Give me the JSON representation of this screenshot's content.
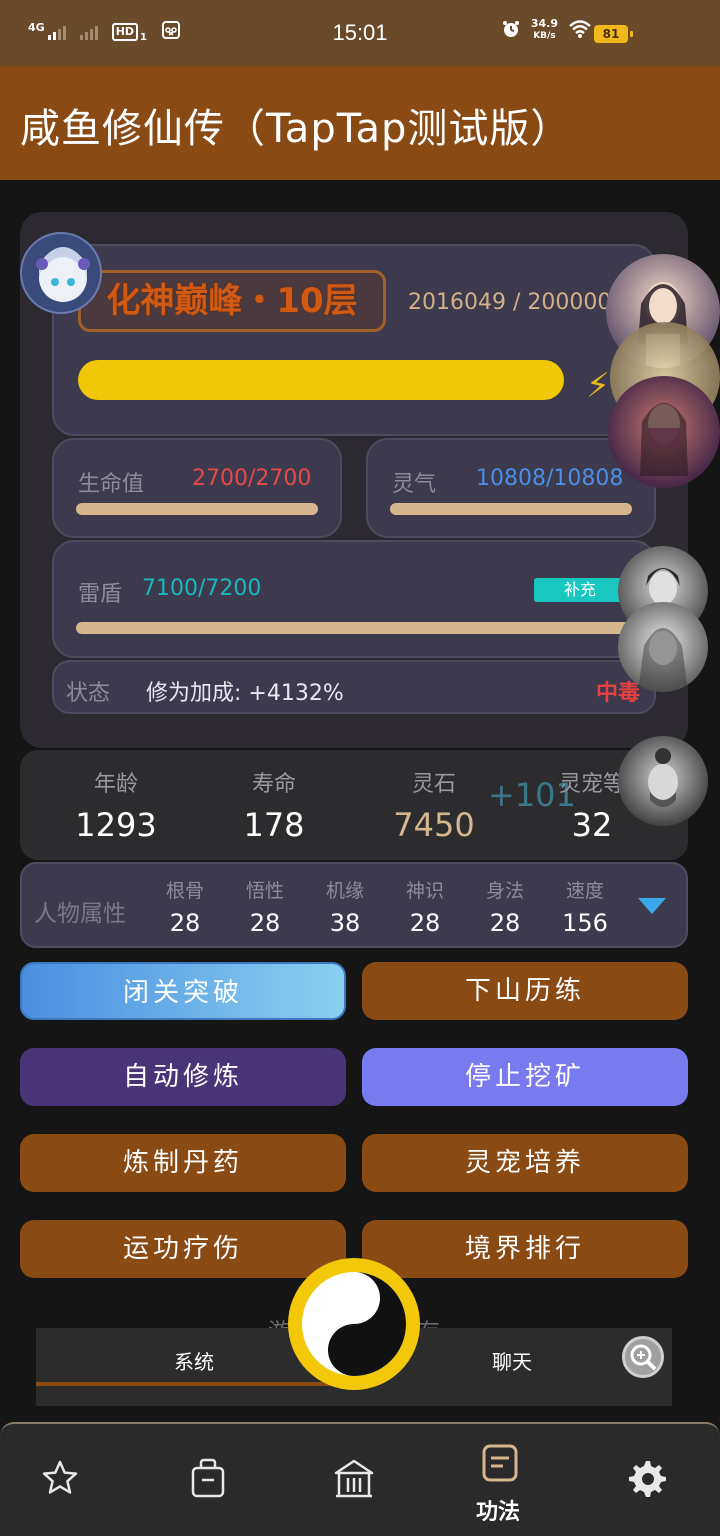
{
  "status_bar": {
    "network": "4G",
    "hd": "HD",
    "hd_sub": "1",
    "time": "15:01",
    "speed_value": "34.9",
    "speed_unit": "KB/s",
    "battery": "81"
  },
  "app": {
    "title": "咸鱼修仙传（TapTap测试版）"
  },
  "realm": {
    "name": "化神巅峰・10层",
    "exp": "2016049 / 2000000",
    "exp_fraction": 1.0
  },
  "hp": {
    "label": "生命值",
    "value": "2700/2700",
    "color": "#e54848"
  },
  "spirit": {
    "label": "灵气",
    "value": "10808/10808",
    "color": "#4a8ee8"
  },
  "shield": {
    "label": "雷盾",
    "value": "7100/7200",
    "color": "#18b8c0",
    "refill_label": "补充"
  },
  "status": {
    "label": "状态",
    "bonus": "修为加成: +4132%",
    "effect": "中毒",
    "effect_color": "#e84040"
  },
  "stats": [
    {
      "label": "年龄",
      "value": "1293"
    },
    {
      "label": "寿命",
      "value": "178"
    },
    {
      "label": "灵石",
      "value": "7450",
      "plus": "+101"
    },
    {
      "label": "灵宠等",
      "value": "32"
    }
  ],
  "attributes": {
    "title": "人物属性",
    "items": [
      {
        "label": "根骨",
        "value": "28"
      },
      {
        "label": "悟性",
        "value": "28"
      },
      {
        "label": "机缘",
        "value": "38"
      },
      {
        "label": "神识",
        "value": "28"
      },
      {
        "label": "身法",
        "value": "28"
      },
      {
        "label": "速度",
        "value": "156"
      }
    ]
  },
  "buttons": {
    "breakthrough": "闭关突破",
    "adventure": "下山历练",
    "auto_cultivate": "自动修炼",
    "stop_mining": "停止挖矿",
    "alchemy": "炼制丹药",
    "pet_training": "灵宠培养",
    "heal": "运功疗伤",
    "ranking": "境界排行"
  },
  "chat": {
    "tab_system": "系统",
    "tab_chat": "聊天",
    "faded_left": "游",
    "faded_right": "存"
  },
  "nav": {
    "active_label": "功法"
  },
  "colors": {
    "brown": "#8a4a14",
    "purple": "#4a3478",
    "periwinkle": "#7a7af0",
    "gradient_blue": "#4a8ee0"
  }
}
